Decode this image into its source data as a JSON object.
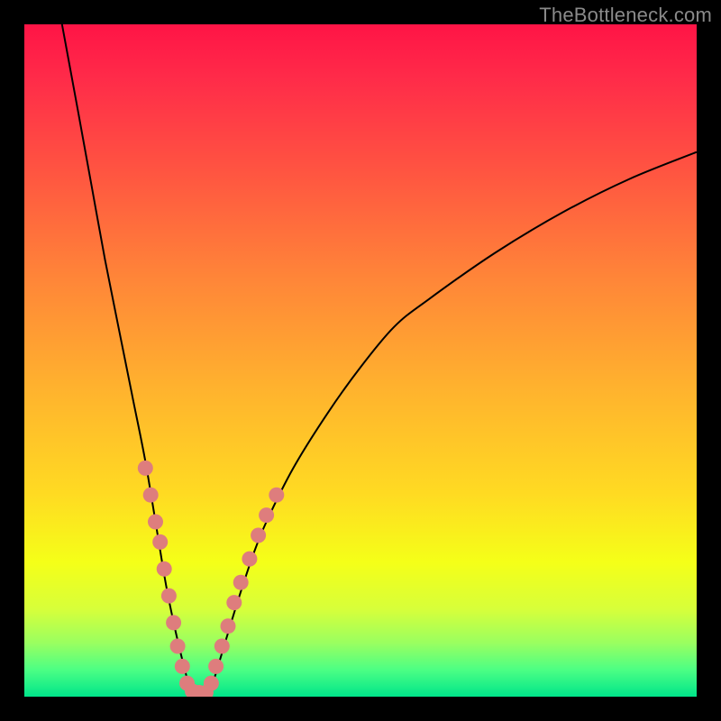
{
  "watermark": "TheBottleneck.com",
  "chart_data": {
    "type": "line",
    "title": "",
    "xlabel": "",
    "ylabel": "",
    "xlim": [
      0,
      100
    ],
    "ylim": [
      0,
      100
    ],
    "grid": false,
    "legend": false,
    "series": [
      {
        "name": "bottleneck-curve-left",
        "x_approx": [
          5.6,
          8,
          10,
          12,
          14,
          16,
          18,
          20,
          21,
          22,
          23,
          24,
          24.8
        ],
        "y_approx": [
          100,
          87,
          76,
          65,
          55,
          45,
          35,
          23,
          17,
          12,
          7.5,
          3.5,
          0.5
        ]
      },
      {
        "name": "bottleneck-curve-right",
        "x_approx": [
          27.5,
          28.5,
          30,
          32,
          34,
          36,
          40,
          45,
          50,
          55,
          60,
          70,
          80,
          90,
          100
        ],
        "y_approx": [
          0.5,
          3.5,
          8.5,
          15,
          21,
          26,
          34,
          42,
          49,
          55,
          59,
          66,
          72,
          77,
          81
        ]
      }
    ],
    "points": {
      "name": "highlighted-data-points",
      "color": "#de7d7d",
      "xy_approx": [
        [
          18.0,
          34.0
        ],
        [
          18.8,
          30.0
        ],
        [
          19.5,
          26.0
        ],
        [
          20.2,
          23.0
        ],
        [
          20.8,
          19.0
        ],
        [
          21.5,
          15.0
        ],
        [
          22.2,
          11.0
        ],
        [
          22.8,
          7.5
        ],
        [
          23.5,
          4.5
        ],
        [
          24.2,
          2.0
        ],
        [
          25.0,
          0.8
        ],
        [
          26.0,
          0.6
        ],
        [
          27.0,
          0.6
        ],
        [
          27.8,
          2.0
        ],
        [
          28.5,
          4.5
        ],
        [
          29.4,
          7.5
        ],
        [
          30.3,
          10.5
        ],
        [
          31.2,
          14.0
        ],
        [
          32.2,
          17.0
        ],
        [
          33.5,
          20.5
        ],
        [
          34.8,
          24.0
        ],
        [
          36.0,
          27.0
        ],
        [
          37.5,
          30.0
        ]
      ]
    },
    "gradient_stops": [
      {
        "pos": 0.0,
        "color": "#ff1446"
      },
      {
        "pos": 0.08,
        "color": "#ff2b49"
      },
      {
        "pos": 0.22,
        "color": "#ff5541"
      },
      {
        "pos": 0.38,
        "color": "#ff8638"
      },
      {
        "pos": 0.54,
        "color": "#ffb22e"
      },
      {
        "pos": 0.7,
        "color": "#ffdb22"
      },
      {
        "pos": 0.8,
        "color": "#f5ff18"
      },
      {
        "pos": 0.87,
        "color": "#d7ff3a"
      },
      {
        "pos": 0.92,
        "color": "#9aff60"
      },
      {
        "pos": 0.96,
        "color": "#4cff84"
      },
      {
        "pos": 1.0,
        "color": "#00e58a"
      }
    ]
  }
}
